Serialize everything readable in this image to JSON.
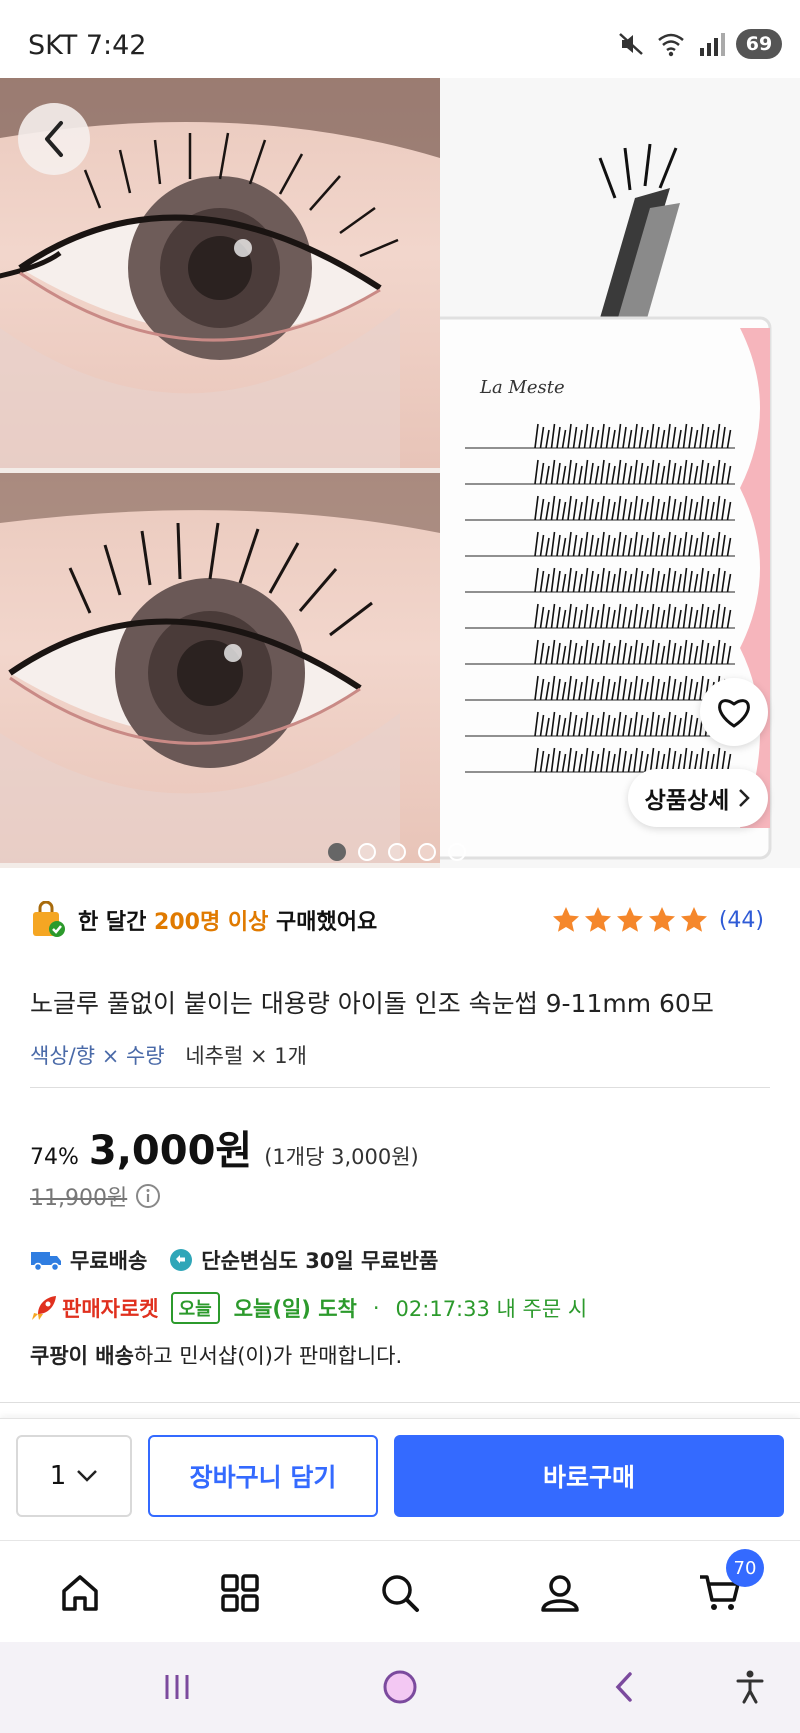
{
  "status_bar": {
    "carrier_time": "SKT 7:42",
    "battery": "69",
    "icons": [
      "mute-icon",
      "wifi-icon",
      "signal-icon"
    ]
  },
  "hero": {
    "product_brand_text": "La Meste",
    "detail_button": "상품상세",
    "image_count": 5,
    "active_image": 1
  },
  "social_proof": {
    "prefix": "한 달간 ",
    "highlight": "200명 이상",
    "suffix": " 구매했어요"
  },
  "rating": {
    "stars": 5,
    "review_count": "(44)"
  },
  "product": {
    "title": "노글루 풀없이 붙이는 대용량 아이돌 인조 속눈썹 9-11mm 60모",
    "option_label": "색상/향 × 수량",
    "option_value": "네추럴 × 1개"
  },
  "price": {
    "discount": "74%",
    "price": "3,000원",
    "unit_price": "(1개당 3,000원)",
    "original_price": "11,900원"
  },
  "shipping": {
    "free_shipping": "무료배송",
    "free_return": "단순변심도 30일 무료반품",
    "rocket_label": "판매자로켓",
    "today_badge": "오늘",
    "arrival": "오늘(일) 도착",
    "separator": "·",
    "cutoff": "02:17:33 내 주문 시",
    "seller_strong": "쿠팡이 배송",
    "seller_rest": "하고 민서샵(이)가 판매합니다."
  },
  "purchase_bar": {
    "quantity": "1",
    "cart_button": "장바구니 담기",
    "buy_button": "바로구매"
  },
  "bottom_nav": {
    "items": [
      "home-icon",
      "category-icon",
      "search-icon",
      "my-page-icon",
      "cart-icon"
    ],
    "cart_badge": "70"
  },
  "colors": {
    "accent": "#346aff",
    "rating_star": "#f5872b",
    "rocket_red": "#e0301e",
    "arrival_green": "#2c9a2c",
    "highlight_orange": "#e07a00"
  }
}
